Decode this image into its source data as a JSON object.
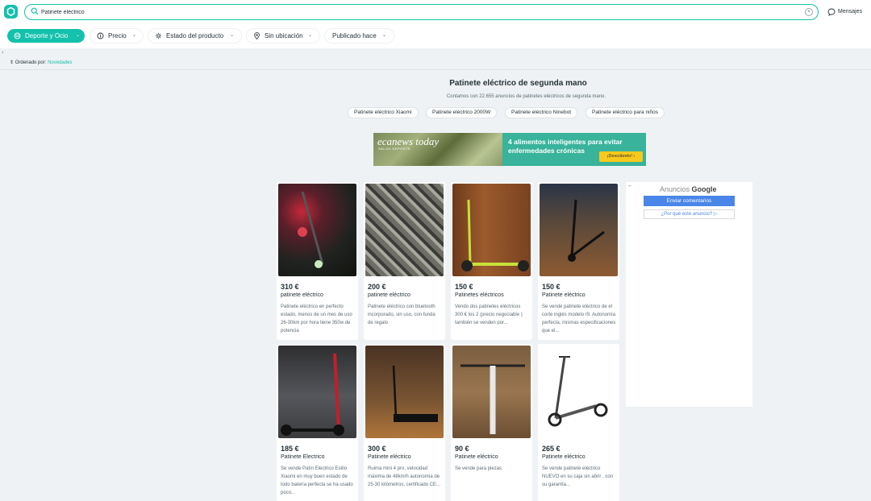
{
  "header": {
    "search_value": "Patinete eléctrico",
    "messages_label": "Mensajes"
  },
  "filters": [
    {
      "label": "Deporte y Ocio",
      "icon": "sport-icon",
      "active": true
    },
    {
      "label": "Precio",
      "icon": "price-icon",
      "active": false
    },
    {
      "label": "Estado del producto",
      "icon": "condition-icon",
      "active": false
    },
    {
      "label": "Sin ubicación",
      "icon": "location-icon",
      "active": false
    },
    {
      "label": "Publicado hace",
      "icon": "",
      "active": false
    }
  ],
  "sort": {
    "label": "Ordenado por:",
    "value": "Novedades"
  },
  "main": {
    "title": "Patinete eléctrico de segunda mano",
    "subtitle": "Contamos con 22.655 anuncios de patinetes eléctricos de segunda mano.",
    "tags": [
      "Patinete eléctrico Xiaomi",
      "Patinete eléctrico 2000W",
      "Patinete eléctrico Ninebot",
      "Patinete eléctrico para niños"
    ]
  },
  "banner": {
    "brand": "ecanews today",
    "brand_sub": "SALUD DEPORTE",
    "text": "4 alimentos inteligentes para evitar enfermedades crónicas",
    "cta": "¡Descúbrelo!  ›"
  },
  "listings": [
    {
      "price": "310 €",
      "title": "patinete eléctrico",
      "desc": "Patinete eléctrico en perfecto estado, menos de un mes de uso 26-30km por hora tiene 350w de potencia"
    },
    {
      "price": "200 €",
      "title": "patinete eléctrico",
      "desc": "Patinete eléctrico con bluetooth incorporado, sin uso, con funda de regalo"
    },
    {
      "price": "150 €",
      "title": "Patinetes eléctricos",
      "desc": "Vendo dos patinetes eléctricos 300 € los 2 (precio negociable ) también se venden por..."
    },
    {
      "price": "150 €",
      "title": "Patinete eléctrico",
      "desc": "Se vende patinete eléctrico de el corte inglés modelo r9. Autonomía perfecta, mismas especificaciones que el..."
    },
    {
      "price": "185 €",
      "title": "Patinete Electrico",
      "desc": "Se vende Patín Electrico Estilo Xiaomi en muy buen estado de todo batería perfecta se ha usado poco..."
    },
    {
      "price": "300 €",
      "title": "Patinete eléctrico",
      "desc": "Ruima mini 4 pro, velocidad máxima de 48km/h autonomía de 25-30 kilómetros, certificado CE..."
    },
    {
      "price": "90 €",
      "title": "Patinete eléctrico",
      "desc": "Se vende para piezas"
    },
    {
      "price": "265 €",
      "title": "Patinete eléctrico",
      "desc": "Se vende patinete eléctrico NUEVO en su caja sin abrir , con su garantía..."
    }
  ],
  "ad": {
    "label_prefix": "Anuncios",
    "label_brand": "Google",
    "send_feedback": "Enviar comentarios",
    "why_ad": "¿Por qué este anuncio? ▷"
  },
  "colors": {
    "accent": "#13c1ac",
    "ad_blue": "#4a86e8",
    "banner_green": "#39b39b",
    "cta_yellow": "#f8c91c"
  }
}
